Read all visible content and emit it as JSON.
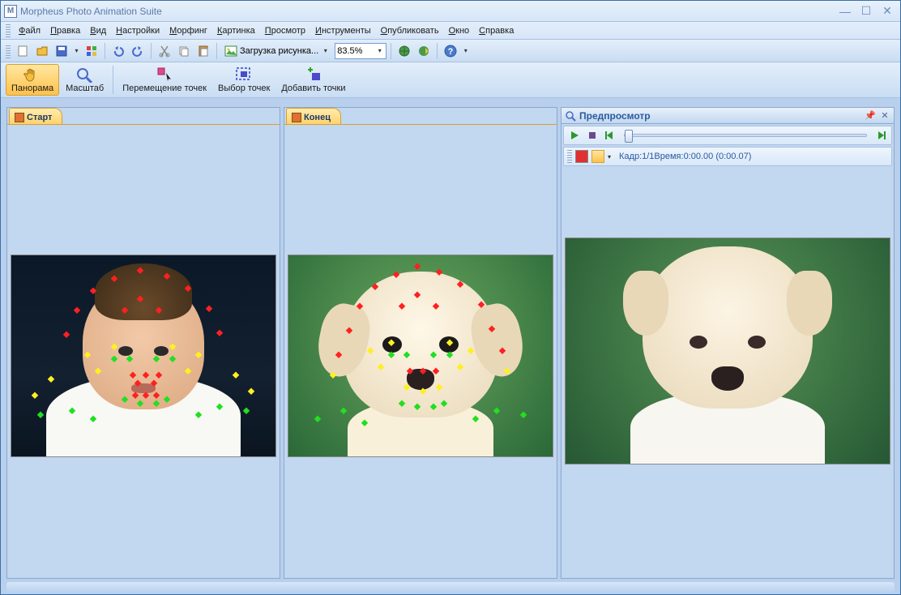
{
  "app": {
    "title": "Morpheus Photo Animation Suite"
  },
  "menu": {
    "file": "Файл",
    "edit": "Правка",
    "view": "Вид",
    "settings": "Настройки",
    "morphing": "Морфинг",
    "picture": "Картинка",
    "preview": "Просмотр",
    "tools": "Инструменты",
    "publish": "Опубликовать",
    "window": "Окно",
    "help": "Справка"
  },
  "toolbar": {
    "load_image": "Загрузка рисунка...",
    "zoom_value": "83.5%"
  },
  "tools": {
    "pan": "Панорама",
    "zoom": "Масштаб",
    "move_dots": "Перемещение точек",
    "select_dots": "Выбор точек",
    "add_dots": "Добавить точки"
  },
  "panels": {
    "start": "Старт",
    "end": "Конец",
    "preview": "Предпросмотр"
  },
  "preview": {
    "frame_info": "Кадр:1/1Время:0:00.00 (0:00.07)"
  }
}
